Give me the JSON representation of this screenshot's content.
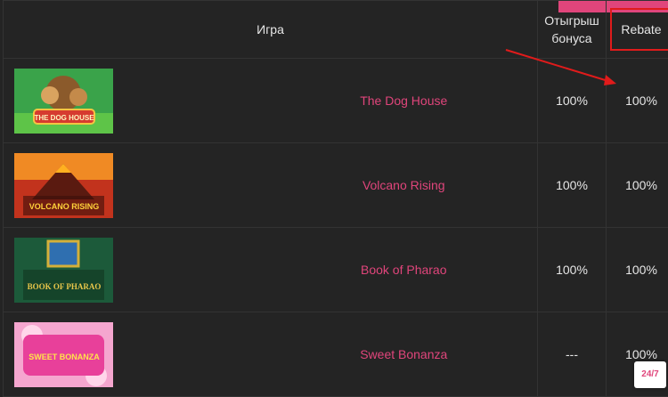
{
  "table": {
    "headers": {
      "game": "Игра",
      "bonus": "Отыгрыш бонуса",
      "rebate": "Rebate"
    },
    "rows": [
      {
        "name": "The Dog House",
        "thumb_text": "THE DOG HOUSE",
        "bonus": "100%",
        "rebate": "100%"
      },
      {
        "name": "Volcano Rising",
        "thumb_text": "VOLCANO RISING",
        "bonus": "100%",
        "rebate": "100%"
      },
      {
        "name": "Book of Pharao",
        "thumb_text": "BOOK OF PHARAO",
        "bonus": "100%",
        "rebate": "100%"
      },
      {
        "name": "Sweet Bonanza",
        "thumb_text": "SWEET BONANZA",
        "bonus": "---",
        "rebate": "100%"
      }
    ]
  },
  "chat_badge": "24/7",
  "colors": {
    "background": "#242424",
    "accent_pink": "#e0457b",
    "highlight_red": "#e01b1b"
  }
}
